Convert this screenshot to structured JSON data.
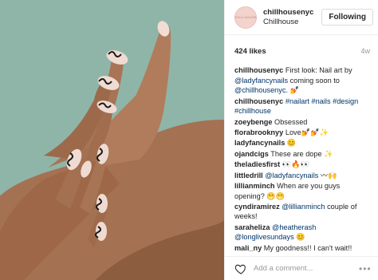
{
  "post": {
    "image_icon": "nail-art-photo",
    "user": {
      "handle": "chillhousenyc",
      "name": "Chillhouse",
      "avatar_text": "CHILLHOUSE"
    },
    "follow_label": "Following",
    "likes": "424 likes",
    "age": "4w",
    "comments": [
      {
        "user": "chillhousenyc",
        "text": "First look: Nail art by",
        "link1": "@ladyfancynails",
        "text2": "coming soon to",
        "link2": "@chillhousenyc.",
        "emoji": "💅"
      },
      {
        "user": "chillhousenyc",
        "links": "#nailart #nails #design",
        "links2": "#chillhouse"
      },
      {
        "user": "zoeybenge",
        "text": "Obsessed"
      },
      {
        "user": "florabrooknyy",
        "text": "Love💅💅✨"
      },
      {
        "user": "ladyfancynails",
        "text": "😊"
      },
      {
        "user": "ojandcigs",
        "text": "These are dope ✨"
      },
      {
        "user": "theladiesfirst",
        "text": "👀🔥👀"
      },
      {
        "user": "littledrill",
        "link": "@ladyfancynails",
        "text": "〰🙌"
      },
      {
        "user": "lillianminch",
        "text": "When are you guys opening?",
        "text2": "😁😁"
      },
      {
        "user": "cyndiramirez",
        "link": "@lillianminch",
        "text": "couple of weeks!"
      },
      {
        "user": "saraheliza",
        "link": "@heatherash",
        "link2": "@longlivesundays",
        "text": "😊"
      },
      {
        "user": "mali_ny",
        "text": "My goodness!! I can't wait!!"
      }
    ],
    "add_comment_placeholder": "Add a comment...",
    "more_icon": "ellipsis-icon",
    "heart_icon": "heart-icon"
  }
}
